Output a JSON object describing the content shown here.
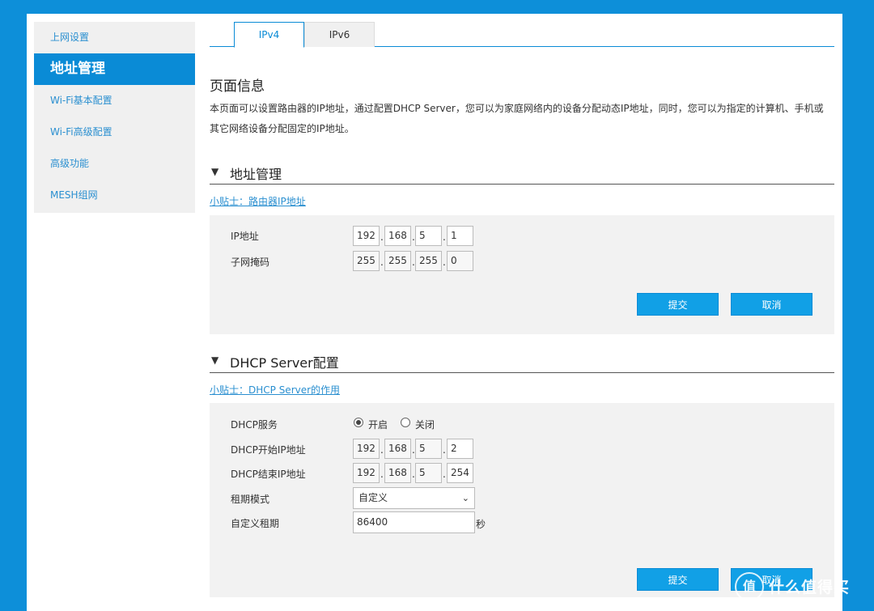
{
  "sidebar": {
    "items": [
      {
        "label": "上网设置"
      },
      {
        "label": "地址管理"
      },
      {
        "label": "Wi-Fi基本配置"
      },
      {
        "label": "Wi-Fi高级配置"
      },
      {
        "label": "高级功能"
      },
      {
        "label": "MESH组网"
      }
    ]
  },
  "tabs": [
    {
      "label": "IPv4"
    },
    {
      "label": "IPv6"
    }
  ],
  "page": {
    "title": "页面信息",
    "description": "本页面可以设置路由器的IP地址，通过配置DHCP Server，您可以为家庭网络内的设备分配动态IP地址，同时，您可以为指定的计算机、手机或其它网络设备分配固定的IP地址。"
  },
  "address_section": {
    "title": "地址管理",
    "tip": "小贴士：路由器IP地址",
    "ip_label": "IP地址",
    "ip": [
      "192",
      "168",
      "5",
      "1"
    ],
    "mask_label": "子网掩码",
    "mask": [
      "255",
      "255",
      "255",
      "0"
    ],
    "submit": "提交",
    "cancel": "取消"
  },
  "dhcp_section": {
    "title": "DHCP Server配置",
    "tip": "小贴士：DHCP Server的作用",
    "service_label": "DHCP服务",
    "on_label": "开启",
    "off_label": "关闭",
    "start_label": "DHCP开始IP地址",
    "start_ip": [
      "192",
      "168",
      "5",
      "2"
    ],
    "end_label": "DHCP结束IP地址",
    "end_ip": [
      "192",
      "168",
      "5",
      "254"
    ],
    "lease_mode_label": "租期模式",
    "lease_mode_value": "自定义",
    "custom_lease_label": "自定义租期",
    "custom_lease_value": "86400",
    "unit": "秒",
    "submit": "提交",
    "cancel": "取消"
  },
  "watermark": {
    "logo": "值",
    "text": "什么值得买"
  }
}
